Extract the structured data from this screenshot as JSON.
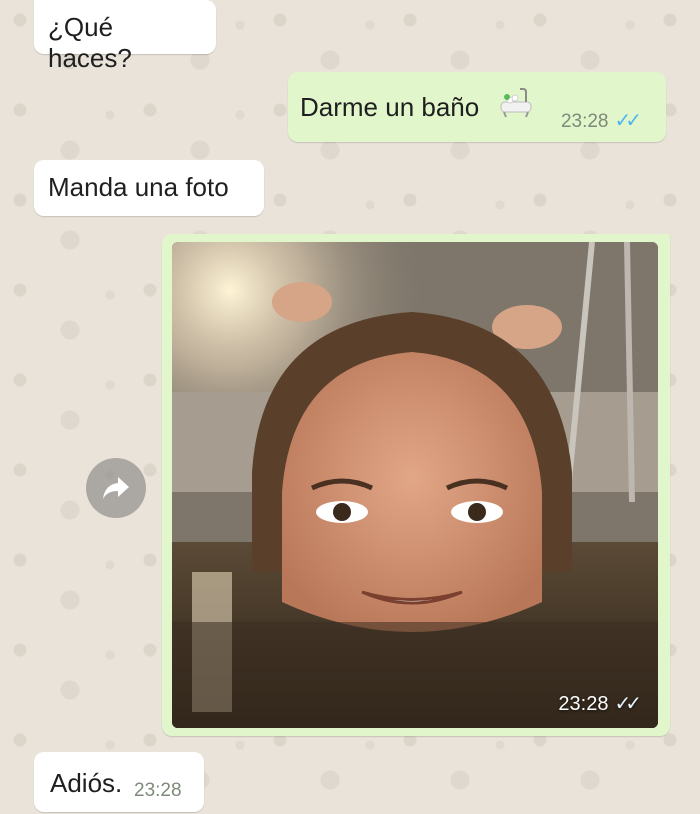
{
  "messages": [
    {
      "id": "m1",
      "direction": "incoming",
      "text": "¿Qué haces?"
    },
    {
      "id": "m2",
      "direction": "outgoing",
      "text": "Darme un baño",
      "emoji": "bathtub-icon",
      "time": "23:28",
      "status": "read"
    },
    {
      "id": "m3",
      "direction": "incoming",
      "text": "Manda una foto"
    },
    {
      "id": "m4",
      "direction": "outgoing",
      "type": "photo",
      "time": "23:28",
      "status": "read"
    },
    {
      "id": "m5",
      "direction": "incoming",
      "text": "Adiós.",
      "time": "23:28"
    }
  ],
  "colors": {
    "incoming_bubble": "#ffffff",
    "outgoing_bubble": "#e1f6cb",
    "read_ticks": "#4fb6ec",
    "chat_background": "#e9e3da"
  },
  "icons": {
    "read_ticks": "✓✓",
    "forward": "forward-icon"
  }
}
